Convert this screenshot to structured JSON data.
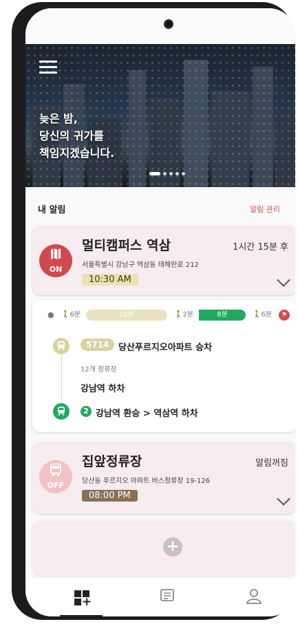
{
  "hero": {
    "line1": "늦은 밤,",
    "line2": "당신의 귀가를",
    "line3": "책임지겠습니다."
  },
  "section": {
    "title": "내 알림",
    "manage_link": "알림 관리"
  },
  "alarm1": {
    "badge_icon": "map-icon",
    "status": "ON",
    "title": "멀티캠퍼스 역삼",
    "remaining": "1시간 15분 후",
    "address": "서울특별시 강남구 역삼동 테헤란로 212",
    "time": "10:30 AM"
  },
  "route": {
    "walk1": "6분",
    "bus": "22분",
    "walk2": "2분",
    "subway": "8분",
    "walk3": "6분",
    "bus_number": "5714",
    "board_stop": "당산푸르지오아파트 승차",
    "stops": "12개 정류장",
    "alight": "강남역 하차",
    "subway_line": "2",
    "transfer": "강남역 환승 > 역삼역 하차",
    "colors": {
      "bus": "#d9d2a0",
      "subway": "#21a95f",
      "walk": "#777777"
    }
  },
  "alarm2": {
    "badge_icon": "bus-icon",
    "status": "OFF",
    "title": "집앞정류장",
    "remaining": "알림꺼짐",
    "address": "당산동 푸르지오 아파트 버스정류장 19-126",
    "time": "08:00 PM"
  },
  "add_card": {
    "icon": "plus-icon"
  },
  "nav": {
    "items": [
      "dashboard-add-icon",
      "list-icon",
      "profile-icon"
    ],
    "active": 0
  },
  "colors": {
    "accent": "#d2494d",
    "card_bg": "#f7ecef",
    "subway_green": "#21a95f"
  }
}
